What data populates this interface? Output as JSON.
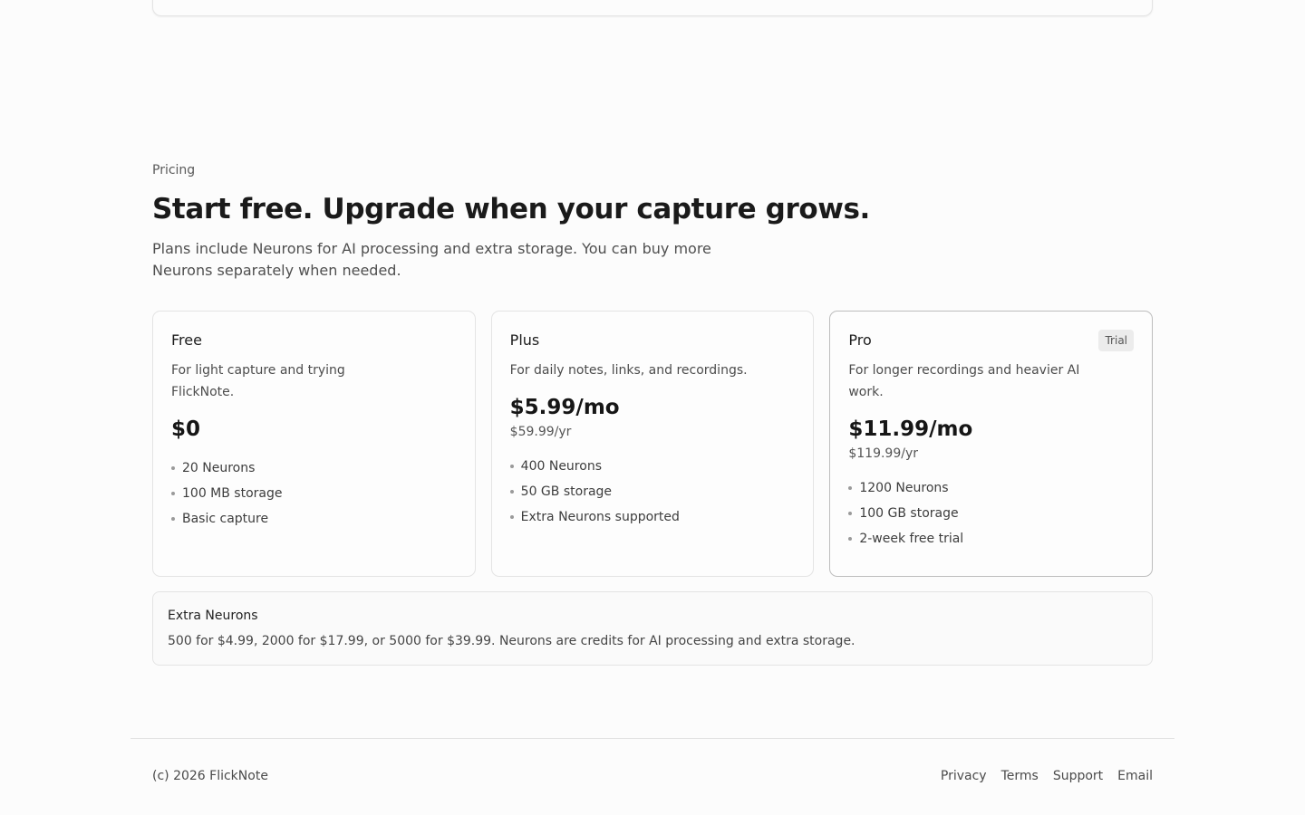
{
  "pricing": {
    "eyebrow": "Pricing",
    "headline": "Start free. Upgrade when your capture grows.",
    "subtitle": "Plans include Neurons for AI processing and extra storage. You can buy more Neurons separately when needed.",
    "plans": [
      {
        "name": "Free",
        "description": "For light capture and trying FlickNote.",
        "price": "$0",
        "features": [
          "20 Neurons",
          "100 MB storage",
          "Basic capture"
        ]
      },
      {
        "name": "Plus",
        "description": "For daily notes, links, and recordings.",
        "price": "$5.99/mo",
        "yearly": "$59.99/yr",
        "features": [
          "400 Neurons",
          "50 GB storage",
          "Extra Neurons supported"
        ]
      },
      {
        "name": "Pro",
        "badge": "Trial",
        "description": "For longer recordings and heavier AI work.",
        "price": "$11.99/mo",
        "yearly": "$119.99/yr",
        "features": [
          "1200 Neurons",
          "100 GB storage",
          "2-week free trial"
        ]
      }
    ],
    "extra": {
      "title": "Extra Neurons",
      "description": "500 for $4.99, 2000 for $17.99, or 5000 for $39.99. Neurons are credits for AI processing and extra storage."
    }
  },
  "footer": {
    "copyright": "(c) 2026 FlickNote",
    "links": [
      "Privacy",
      "Terms",
      "Support",
      "Email"
    ]
  }
}
